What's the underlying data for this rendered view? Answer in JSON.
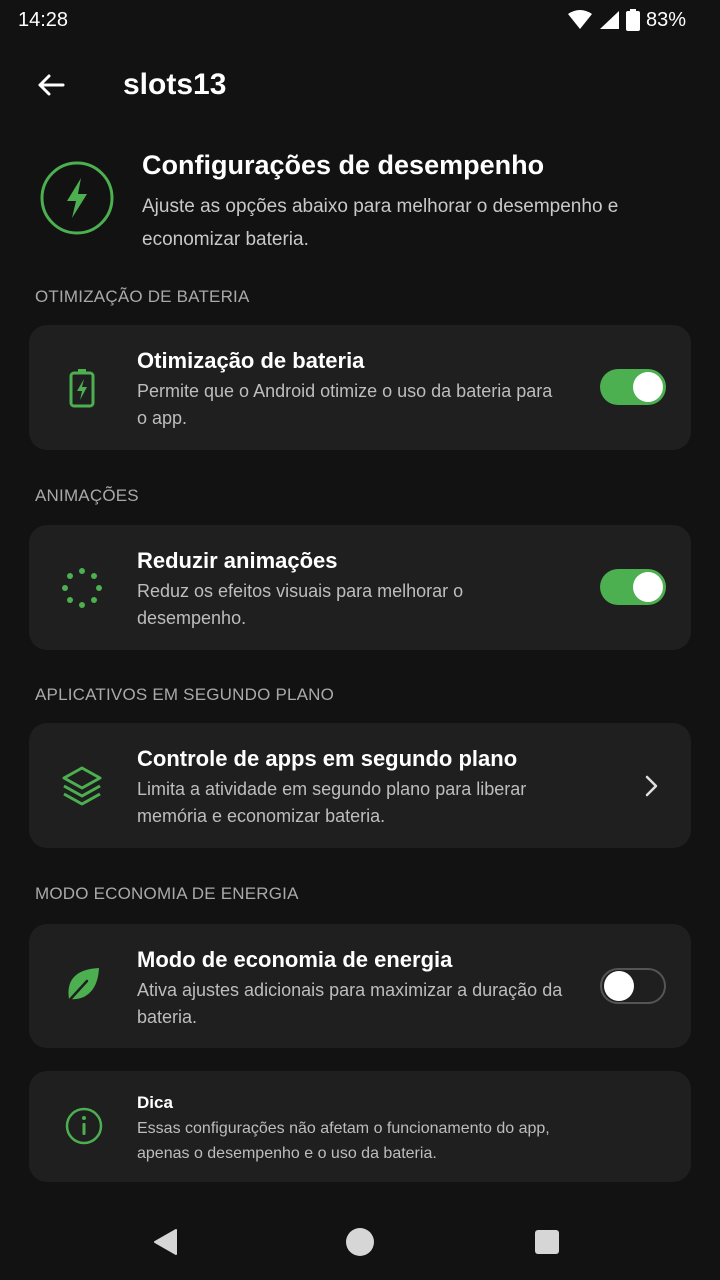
{
  "status_bar": {
    "time": "14:28",
    "battery": "83%",
    "icons": [
      "wifi-icon",
      "signal-icon",
      "battery-icon"
    ]
  },
  "app_bar": {
    "title": "slots13",
    "back_icon": "arrow-left-icon"
  },
  "header": {
    "icon": "lightning-bolt-icon",
    "title": "Configurações de desempenho",
    "subtitle": "Ajuste as opções abaixo para melhorar o desempenho e economizar bateria."
  },
  "sections": [
    {
      "label": "OTIMIZAÇÃO DE BATERIA",
      "item": {
        "icon": "battery-bolt-icon",
        "title": "Otimização de bateria",
        "description": "Permite que o Android otimize o uso da bateria para o app.",
        "control": "toggle",
        "enabled": true
      }
    },
    {
      "label": "ANIMAÇÕES",
      "item": {
        "icon": "dotted-circle-icon",
        "title": "Reduzir animações",
        "description": "Reduz os efeitos visuais para melhorar o desempenho.",
        "control": "toggle",
        "enabled": true
      }
    },
    {
      "label": "APLICATIVOS EM SEGUNDO PLANO",
      "item": {
        "icon": "layers-icon",
        "title": "Controle de apps em segundo plano",
        "description": "Limita a atividade em segundo plano para liberar memória e economizar bateria.",
        "control": "chevron"
      }
    },
    {
      "label": "MODO ECONOMIA DE ENERGIA",
      "item": {
        "icon": "leaf-icon",
        "title": "Modo de economia de energia",
        "description": "Ativa ajustes adicionais para maximizar a duração da bateria.",
        "control": "toggle",
        "enabled": false
      }
    }
  ],
  "tip": {
    "icon": "info-icon",
    "title": "Dica",
    "description": "Essas configurações não afetam o funcionamento do app, apenas o desempenho e o uso da bateria."
  },
  "nav_bar": {
    "buttons": [
      "back-triangle-icon",
      "home-circle-icon",
      "recents-square-icon"
    ]
  },
  "colors": {
    "accent": "#4caf50",
    "background": "#121212",
    "card": "#1f1f1f",
    "text_secondary": "#bdbdbd"
  }
}
